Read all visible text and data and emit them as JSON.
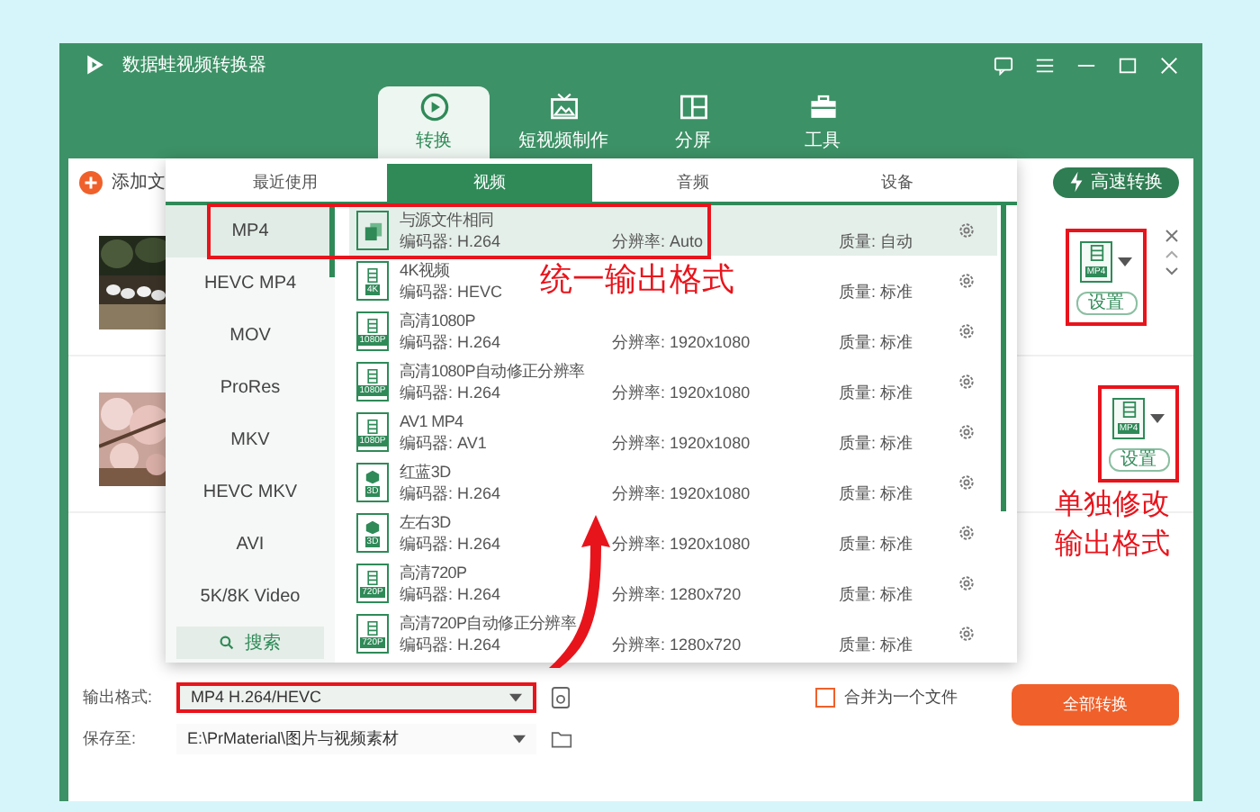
{
  "window": {
    "title": "数据蛙视频转换器"
  },
  "nav_tabs": [
    {
      "kind": "convert",
      "label": "转换",
      "selected": true
    },
    {
      "kind": "tv",
      "label": "短视频制作",
      "selected": false
    },
    {
      "kind": "split",
      "label": "分屏",
      "selected": false
    },
    {
      "kind": "toolbox",
      "label": "工具",
      "selected": false
    }
  ],
  "toolbar": {
    "add_files": "添加文",
    "fast_convert": "高速转换"
  },
  "files": [
    {
      "format_badge": "MP4",
      "settings": "设置",
      "hovered": true,
      "highlighted": true
    },
    {
      "format_badge": "MP4",
      "settings": "设置",
      "hovered": false,
      "highlighted": true
    }
  ],
  "files_note": "单独修改输出格式",
  "popup": {
    "tabs": [
      {
        "label": "最近使用",
        "selected": false
      },
      {
        "label": "视频",
        "selected": true
      },
      {
        "label": "音频",
        "selected": false
      },
      {
        "label": "设备",
        "selected": false
      }
    ],
    "formats": [
      {
        "label": "MP4",
        "selected": true
      },
      {
        "label": "HEVC MP4",
        "selected": false
      },
      {
        "label": "MOV",
        "selected": false
      },
      {
        "label": "ProRes",
        "selected": false
      },
      {
        "label": "MKV",
        "selected": false
      },
      {
        "label": "HEVC MKV",
        "selected": false
      },
      {
        "label": "AVI",
        "selected": false
      },
      {
        "label": "5K/8K Video",
        "selected": false
      }
    ],
    "search": "搜索",
    "highlight_frame": true,
    "arrow": true,
    "presets": [
      {
        "kind": "copy",
        "name": "与源文件相同",
        "codec_label": "编码器:",
        "codec": "H.264",
        "res_label": "分辨率:",
        "res": "Auto",
        "quality_label": "质量:",
        "quality": "自动",
        "selected": true
      },
      {
        "kind": "film",
        "badge": "4K",
        "name": "4K视频",
        "codec_label": "编码器:",
        "codec": "HEVC",
        "note": "统一输出格式",
        "quality_label": "质量:",
        "quality": "标准",
        "selected": false
      },
      {
        "kind": "film",
        "badge": "1080P",
        "name": "高清1080P",
        "codec_label": "编码器:",
        "codec": "H.264",
        "res_label": "分辨率:",
        "res": "1920x1080",
        "quality_label": "质量:",
        "quality": "标准",
        "selected": false
      },
      {
        "kind": "film",
        "badge": "1080P",
        "name": "高清1080P自动修正分辨率",
        "codec_label": "编码器:",
        "codec": "H.264",
        "res_label": "分辨率:",
        "res": "1920x1080",
        "quality_label": "质量:",
        "quality": "标准",
        "selected": false
      },
      {
        "kind": "film",
        "badge": "1080P",
        "name": "AV1 MP4",
        "codec_label": "编码器:",
        "codec": "AV1",
        "res_label": "分辨率:",
        "res": "1920x1080",
        "quality_label": "质量:",
        "quality": "标准",
        "selected": false
      },
      {
        "kind": "cube",
        "badge": "3D",
        "name": "红蓝3D",
        "codec_label": "编码器:",
        "codec": "H.264",
        "res_label": "分辨率:",
        "res": "1920x1080",
        "quality_label": "质量:",
        "quality": "标准",
        "selected": false
      },
      {
        "kind": "cube",
        "badge": "3D",
        "name": "左右3D",
        "codec_label": "编码器:",
        "codec": "H.264",
        "res_label": "分辨率:",
        "res": "1920x1080",
        "quality_label": "质量:",
        "quality": "标准",
        "selected": false
      },
      {
        "kind": "film",
        "badge": "720P",
        "name": "高清720P",
        "codec_label": "编码器:",
        "codec": "H.264",
        "res_label": "分辨率:",
        "res": "1280x720",
        "quality_label": "质量:",
        "quality": "标准",
        "selected": false
      },
      {
        "kind": "film",
        "badge": "720P",
        "name": "高清720P自动修正分辨率",
        "codec_label": "编码器:",
        "codec": "H.264",
        "res_label": "分辨率:",
        "res": "1280x720",
        "quality_label": "质量:",
        "quality": "标准",
        "selected": false
      }
    ]
  },
  "output": {
    "format_label": "输出格式:",
    "format_value": "MP4 H.264/HEVC",
    "highlighted": true,
    "save_label": "保存至:",
    "save_path": "E:\\PrMaterial\\图片与视频素材"
  },
  "merge": {
    "label": "合并为一个文件",
    "checked": false
  },
  "convert_all": "全部转换"
}
